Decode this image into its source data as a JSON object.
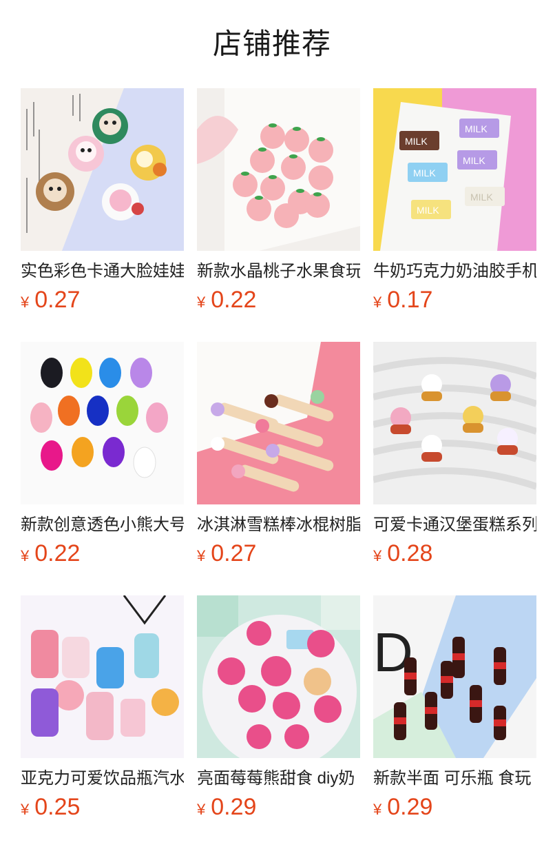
{
  "header": {
    "title": "店铺推荐"
  },
  "currency_symbol": "¥",
  "products": [
    {
      "title": "实色彩色卡通大脸娃娃",
      "price": "0.27",
      "image": "cartoon-dolls-charms"
    },
    {
      "title": "新款水晶桃子水果食玩",
      "price": "0.22",
      "image": "crystal-peach-charms"
    },
    {
      "title": "牛奶巧克力奶油胶手机",
      "price": "0.17",
      "image": "milk-chocolate-charms"
    },
    {
      "title": "新款创意透色小熊大号",
      "price": "0.22",
      "image": "translucent-bear-charms"
    },
    {
      "title": "冰淇淋雪糕棒冰棍树脂",
      "price": "0.27",
      "image": "ice-cream-stick-charms"
    },
    {
      "title": "可爱卡通汉堡蛋糕系列",
      "price": "0.28",
      "image": "cartoon-burger-charms"
    },
    {
      "title": "亚克力可爱饮品瓶汽水",
      "price": "0.25",
      "image": "acrylic-drink-bottle-charms"
    },
    {
      "title": "亮面莓莓熊甜食 diy奶",
      "price": "0.29",
      "image": "strawberry-bear-charms"
    },
    {
      "title": "新款半面 可乐瓶 食玩",
      "price": "0.29",
      "image": "cola-bottle-charms"
    }
  ]
}
